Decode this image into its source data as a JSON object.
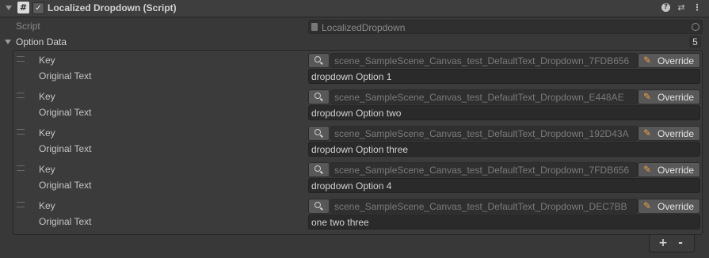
{
  "component": {
    "title": "Localized Dropdown (Script)",
    "enabled": true,
    "icons": [
      "help-icon",
      "preset-icon",
      "kebab-menu-icon"
    ]
  },
  "script_row": {
    "label": "Script",
    "value": "LocalizedDropdown"
  },
  "option_data": {
    "label": "Option Data",
    "count": "5",
    "key_label": "Key",
    "text_label": "Original Text",
    "override_label": "Override",
    "items": [
      {
        "key": "scene_SampleScene_Canvas_test_DefaultText_Dropdown_7FDB656",
        "text": "dropdown Option 1"
      },
      {
        "key": "scene_SampleScene_Canvas_test_DefaultText_Dropdown_E448AE",
        "text": "dropdown Option two"
      },
      {
        "key": "scene_SampleScene_Canvas_test_DefaultText_Dropdown_192D43A",
        "text": "dropdown Option three"
      },
      {
        "key": "scene_SampleScene_Canvas_test_DefaultText_Dropdown_7FDB656",
        "text": "dropdown Option 4"
      },
      {
        "key": "scene_SampleScene_Canvas_test_DefaultText_Dropdown_DEC7BB",
        "text": "one two three"
      }
    ],
    "add_label": "+",
    "remove_label": "-"
  }
}
